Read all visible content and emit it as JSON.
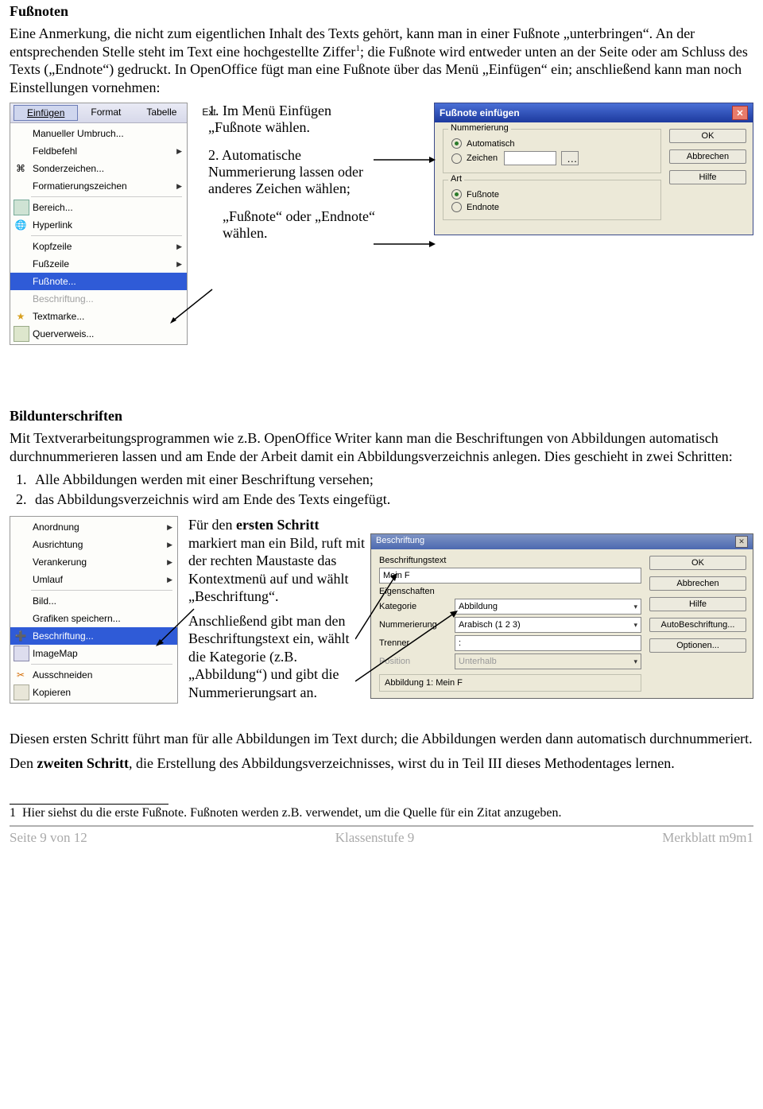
{
  "title_fussnoten": "Fußnoten",
  "para1": "Eine Anmerkung, die nicht zum eigentlichen Inhalt des Texts gehört, kann man in einer Fußnote „unterbringen“. An der entsprechenden Stelle steht im Text eine hochgestellte Ziffer",
  "sup1": "1",
  "para1b": "; die Fußnote wird entweder unten an der Seite oder am Schluss des Texts („Endnote“) gedruckt. In OpenOffice fügt man eine Fußnote über das Menü „Einfügen“ ein; anschließend kann man noch Einstellungen vornehmen:",
  "menu_bar": {
    "einfuegen": "Einfügen",
    "format": "Format",
    "tabelle": "Tabelle",
    "ext": "Ext"
  },
  "menu_items": {
    "umbruch": "Manueller Umbruch...",
    "feld": "Feldbefehl",
    "sonder": "Sonderzeichen...",
    "formatz": "Formatierungszeichen",
    "bereich": "Bereich...",
    "hyperlink": "Hyperlink",
    "kopf": "Kopfzeile",
    "fuss": "Fußzeile",
    "fussnote": "Fußnote...",
    "beschr": "Beschriftung...",
    "textmarke": "Textmarke...",
    "querverweis": "Querverweis..."
  },
  "instr1_num": "1.",
  "instr1": "Im Menü Einfügen „Fußnote wählen.",
  "instr2_num": "2.",
  "instr2": "Automatische Nummerierung lassen oder anderes Zeichen wählen;",
  "instr2b": "„Fußnote“ oder „Endnote“ wählen.",
  "dlg": {
    "title": "Fußnote einfügen",
    "grp_num": "Nummerierung",
    "auto": "Automatisch",
    "zeichen": "Zeichen",
    "grp_art": "Art",
    "fussnote": "Fußnote",
    "endnote": "Endnote",
    "ok": "OK",
    "abbrechen": "Abbrechen",
    "hilfe": "Hilfe"
  },
  "title_bild": "Bildunterschriften",
  "bild_p1": "Mit Textverarbeitungsprogrammen wie z.B. OpenOffice Writer kann man die Beschriftungen von Abbildungen automatisch durchnummerieren lassen und am Ende der Arbeit damit ein Abbildungsverzeichnis anlegen. Dies geschieht in zwei Schritten:",
  "bild_li1": "Alle Abbildungen werden mit einer Beschriftung versehen;",
  "bild_li2": "das Abbildungsverzeichnis wird am Ende des Texts eingefügt.",
  "ctx2": {
    "anordnung": "Anordnung",
    "ausrichtung": "Ausrichtung",
    "verankerung": "Verankerung",
    "umlauf": "Umlauf",
    "bild": "Bild...",
    "grafik": "Grafiken speichern...",
    "beschr": "Beschriftung...",
    "imagemap": "ImageMap",
    "ausschneiden": "Ausschneiden",
    "kopieren": "Kopieren"
  },
  "col_p1a": "Für den ",
  "col_p1_bold": "ersten Schritt",
  "col_p1b": " markiert man ein Bild, ruft mit der rechten Maustaste das Kontextmenü auf und wählt „Beschriftung“.",
  "col_p2": "Anschließend gibt man den Beschriftungstext ein, wählt die Kategorie (z.B. „Abbildung“) und gibt die Nummerierungsart an.",
  "dlg2": {
    "title": "Beschriftung",
    "btext_lbl": "Beschriftungstext",
    "btext_val": "Mein F",
    "eig": "Eigenschaften",
    "kat_lbl": "Kategorie",
    "kat_val": "Abbildung",
    "num_lbl": "Nummerierung",
    "num_val": "Arabisch (1 2 3)",
    "tren_lbl": "Trenner",
    "tren_val": ":",
    "pos_lbl": "Position",
    "pos_val": "Unterhalb",
    "preview": "Abbildung 1: Mein F",
    "ok": "OK",
    "abbr": "Abbrechen",
    "hilfe": "Hilfe",
    "auto": "AutoBeschriftung...",
    "opt": "Optionen..."
  },
  "after_p1": "Diesen ersten Schritt führt man für alle Abbildungen im Text durch; die Abbildungen werden dann automatisch durchnummeriert.",
  "after_p2a": "Den ",
  "after_p2_bold": "zweiten Schritt",
  "after_p2b": ", die Erstellung des Abbildungsverzeichnisses, wirst du in Teil III dieses Methodentages lernen.",
  "footnote_num": "1",
  "footnote_txt": "Hier siehst du die erste Fußnote. Fußnoten werden z.B. verwendet, um die Quelle für ein Zitat anzugeben.",
  "footer": {
    "l": "Seite 9 von 12",
    "c": "Klassenstufe 9",
    "r": "Merkblatt m9m1"
  }
}
